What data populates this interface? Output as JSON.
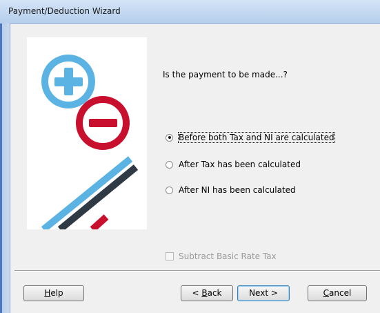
{
  "window": {
    "title": "Payment/Deduction Wizard"
  },
  "main": {
    "question": "Is the payment to be made...?",
    "options": [
      {
        "label": "Before both Tax and NI are calculated",
        "selected": true
      },
      {
        "label": "After Tax has been calculated",
        "selected": false
      },
      {
        "label": "After NI has been calculated",
        "selected": false
      }
    ],
    "checkbox": {
      "label": "Subtract Basic Rate Tax",
      "checked": false,
      "enabled": false
    }
  },
  "buttons": {
    "help": {
      "mnemonic": "H",
      "rest": "elp"
    },
    "back": {
      "prefix": "< ",
      "mnemonic": "B",
      "rest": "ack"
    },
    "next": {
      "label": "Next >"
    },
    "cancel": {
      "mnemonic": "C",
      "rest": "ancel"
    }
  },
  "colors": {
    "plus_blue": "#5bb3e3",
    "minus_red": "#c8102e",
    "stripe_dark": "#2f3a45"
  }
}
